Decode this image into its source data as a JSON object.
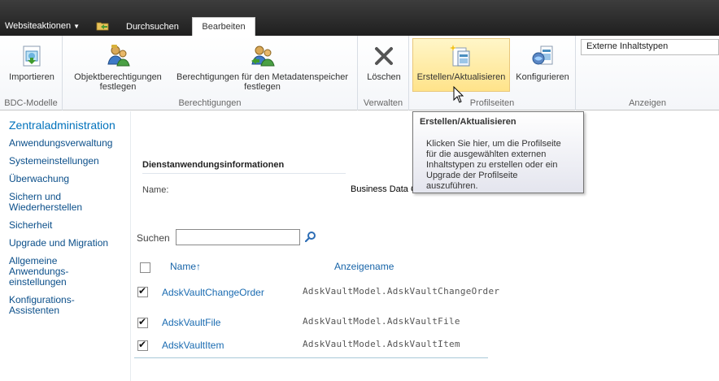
{
  "topbar": {
    "site_actions": "Websiteaktionen",
    "tabs": [
      {
        "label": "Durchsuchen",
        "active": false
      },
      {
        "label": "Bearbeiten",
        "active": true
      }
    ]
  },
  "ribbon": {
    "groups": [
      {
        "label": "BDC-Modelle",
        "buttons": [
          {
            "label": "Importieren",
            "icon": "import-icon"
          }
        ]
      },
      {
        "label": "Berechtigungen",
        "buttons": [
          {
            "label_line1": "Objektberechtigungen",
            "label_line2": "festlegen",
            "icon": "object-permissions-icon"
          },
          {
            "label_line1": "Berechtigungen für den Metadatenspeicher",
            "label_line2": "festlegen",
            "icon": "metadata-permissions-icon"
          }
        ]
      },
      {
        "label": "Verwalten",
        "buttons": [
          {
            "label": "Löschen",
            "icon": "delete-icon"
          }
        ]
      },
      {
        "label": "Profilseiten",
        "buttons": [
          {
            "label": "Erstellen/Aktualisieren",
            "icon": "create-update-icon",
            "active": true
          },
          {
            "label": "Konfigurieren",
            "icon": "configure-icon"
          }
        ]
      },
      {
        "label": "Anzeigen",
        "select_value": "Externe Inhaltstypen"
      }
    ]
  },
  "leftnav": {
    "title": "Zentraladministration",
    "items": [
      {
        "label": "Anwendungsverwaltung"
      },
      {
        "label": "Systemeinstellungen"
      },
      {
        "label": "Überwachung"
      },
      {
        "label_lines": [
          "Sichern und",
          "Wiederherstellen"
        ]
      },
      {
        "label": "Sicherheit"
      },
      {
        "label": "Upgrade und Migration"
      },
      {
        "label_lines": [
          "Allgemeine",
          "Anwendungs-",
          "einstellungen"
        ]
      },
      {
        "label_lines": [
          "Konfigurations-",
          "Assistenten"
        ]
      }
    ]
  },
  "main": {
    "section_title": "Dienstanwendungsinformationen",
    "name_label": "Name:",
    "name_value": "Business Data Connectivity",
    "search_label": "Suchen",
    "search_value": "",
    "columns": {
      "name": "Name↑",
      "display": "Anzeigename"
    },
    "rows": [
      {
        "name": "AdskVaultChangeOrder",
        "display": "AdskVaultModel.AdskVaultChangeOrder",
        "checked": true
      },
      {
        "name": "AdskVaultFile",
        "display": "AdskVaultModel.AdskVaultFile",
        "checked": true
      },
      {
        "name": "AdskVaultItem",
        "display": "AdskVaultModel.AdskVaultItem",
        "checked": true
      }
    ]
  },
  "tooltip": {
    "title": "Erstellen/Aktualisieren",
    "body_lines": [
      "Klicken Sie hier, um die Profilseite",
      "für die ausgewählten externen",
      "Inhaltstypen zu erstellen oder ein",
      "Upgrade der Profilseite",
      "auszuführen."
    ]
  },
  "colors": {
    "link": "#1a6bb1",
    "nav_title": "#0072bc",
    "active_button": "#ffe38a"
  }
}
